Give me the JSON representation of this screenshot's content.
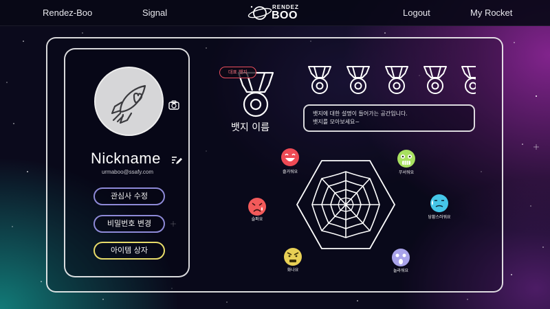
{
  "nav": {
    "brand_link": "Rendez-Boo",
    "signal": "Signal",
    "logout": "Logout",
    "my_rocket": "My Rocket",
    "logo_top": "RENDEZ",
    "logo_bottom": "BOO"
  },
  "profile": {
    "nickname": "Nickname",
    "email": "urmaboo@ssafy.com",
    "buttons": {
      "interests": "관심사 수정",
      "password": "비밀번호 변경",
      "items": "아이템 상자"
    }
  },
  "badges": {
    "representative_tag": "대표 뱃지",
    "name": "뱃지 이름",
    "description_line1": "뱃지에 대한 설명이 들어가는 공간입니다.",
    "description_line2": "뱃지를 모아보세요~"
  },
  "emotions": [
    {
      "label": "즐거워요",
      "color": "#ee4a55"
    },
    {
      "label": "무서워요",
      "color": "#a8e060"
    },
    {
      "label": "당황스러워요",
      "color": "#45c6e8"
    },
    {
      "label": "놀라워요",
      "color": "#a9a3ea"
    },
    {
      "label": "화나요",
      "color": "#e8d055"
    },
    {
      "label": "슬퍼요",
      "color": "#f25a5a"
    }
  ],
  "colors": {
    "pill_purple": "#8e8ad8",
    "pill_yellow": "#e8dc6a",
    "rep_tag_red": "#ef4f5f"
  }
}
